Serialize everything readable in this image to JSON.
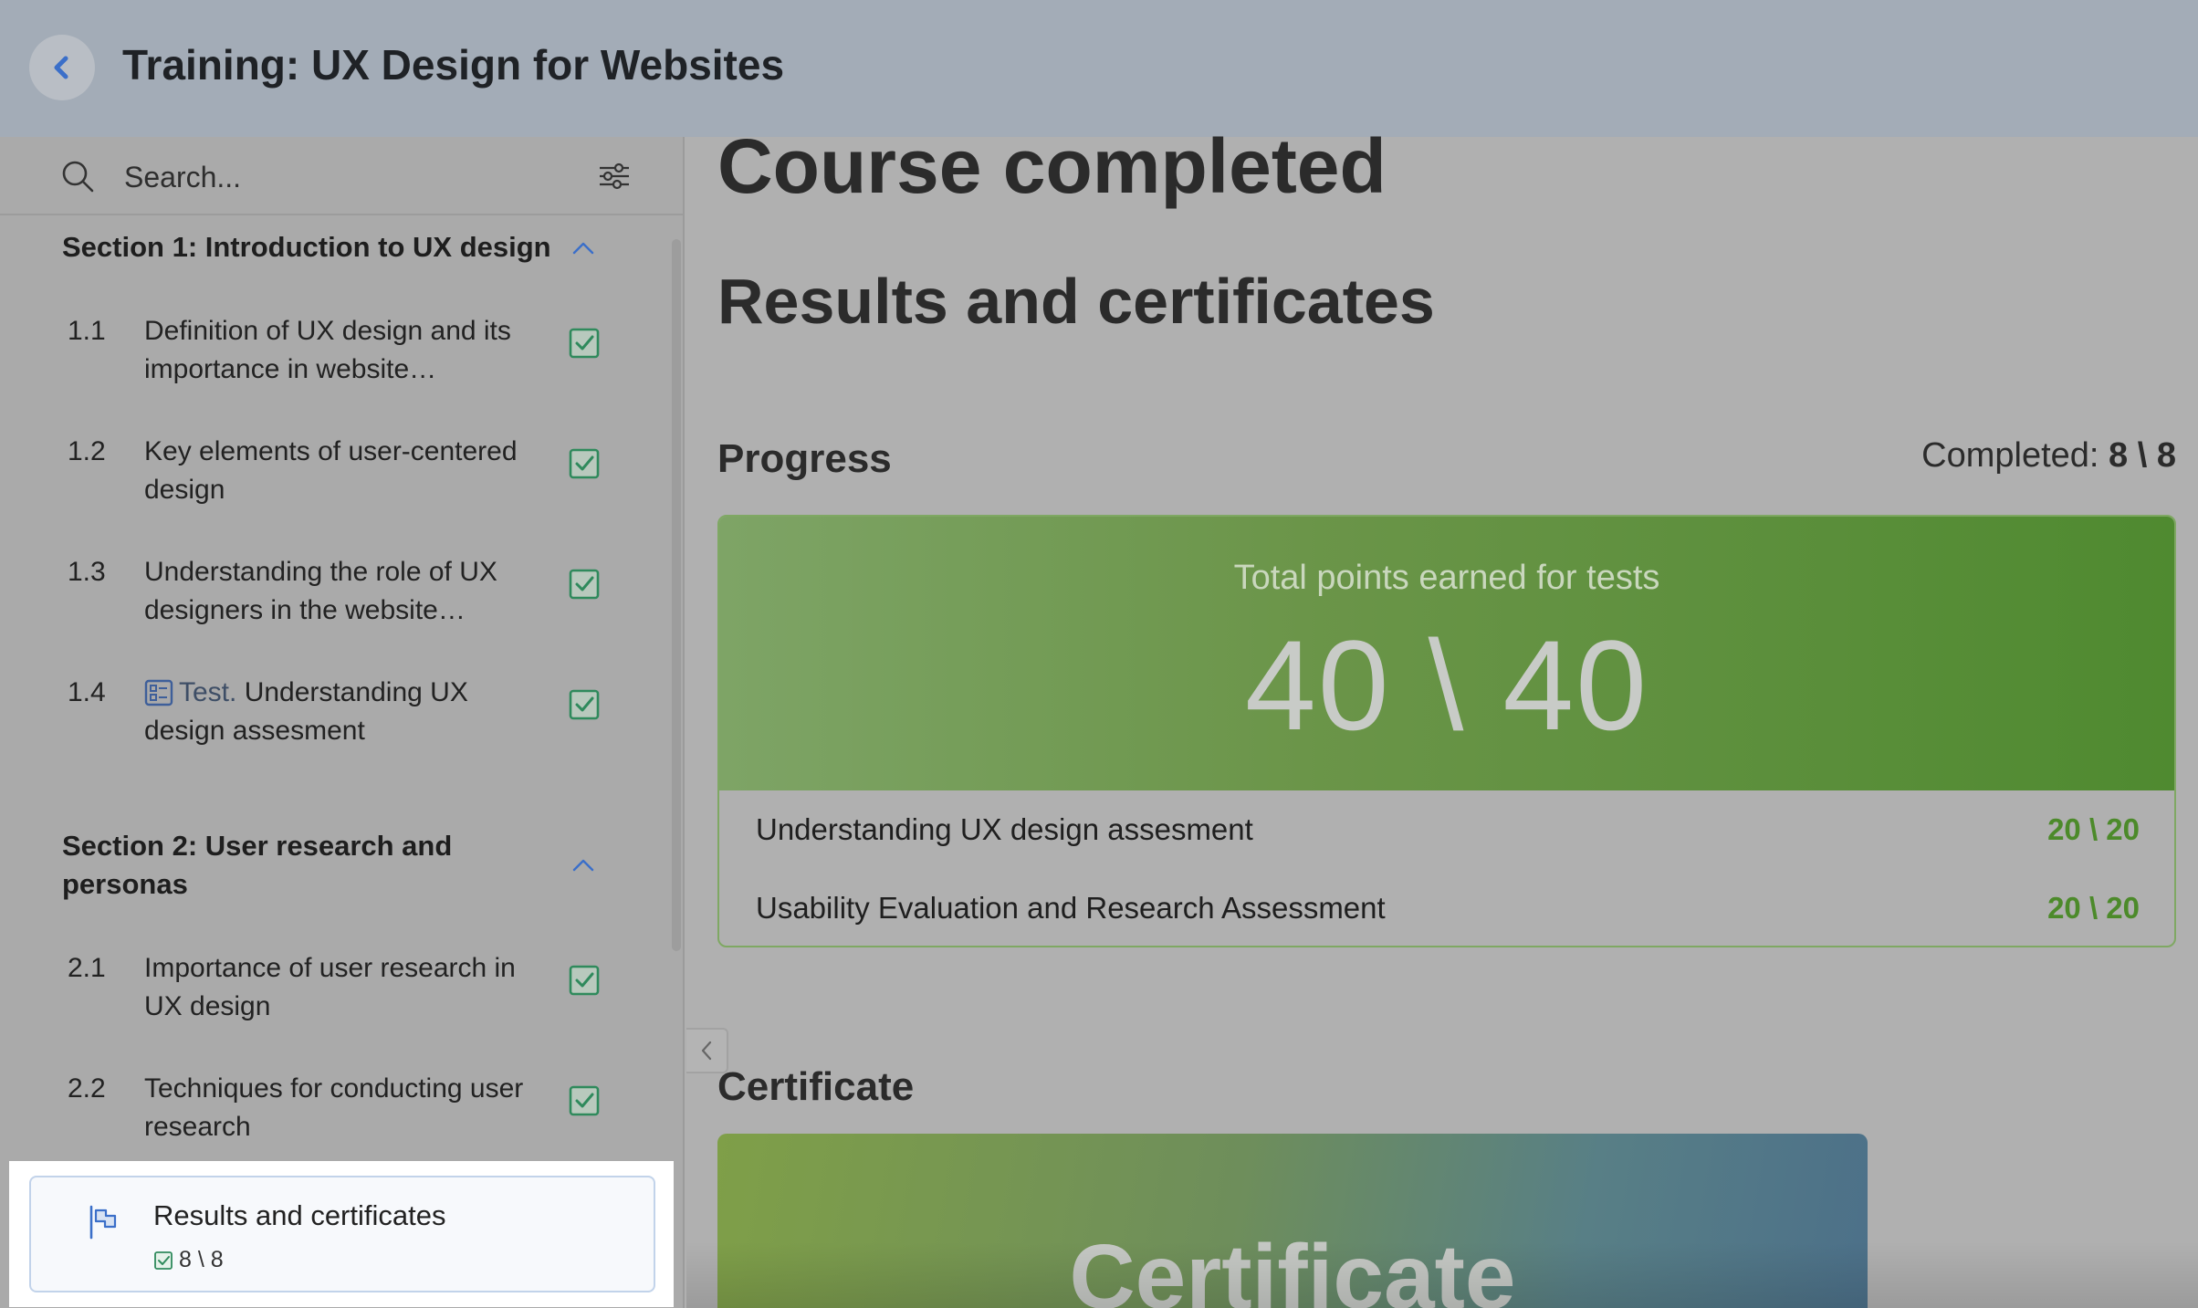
{
  "header": {
    "title": "Training: UX Design for Websites"
  },
  "search": {
    "placeholder": "Search..."
  },
  "sidebar": {
    "sections": [
      {
        "title": "Section 1: Introduction to UX design",
        "lessons": [
          {
            "num": "1.1",
            "text": "Definition of UX design and its importance in website…"
          },
          {
            "num": "1.2",
            "text": "Key elements of user-centered design"
          },
          {
            "num": "1.3",
            "text": "Understanding the role of UX designers in the website…"
          },
          {
            "num": "1.4",
            "prefix": "Test.",
            "text": "Understanding UX design assesment"
          }
        ]
      },
      {
        "title": "Section 2: User research and personas",
        "lessons": [
          {
            "num": "2.1",
            "text": "Importance of user research in UX design"
          },
          {
            "num": "2.2",
            "text": "Techniques for conducting user research"
          }
        ]
      }
    ],
    "results": {
      "title": "Results and certificates",
      "count": "8 \\ 8"
    }
  },
  "main": {
    "course_status": "Course completed",
    "heading": "Results and certificates",
    "progress": {
      "label": "Progress",
      "completed_label": "Completed:",
      "completed_value": "8 \\ 8",
      "total_label": "Total points earned for tests",
      "total_value": "40 \\ 40",
      "tests": [
        {
          "name": "Understanding UX design assesment",
          "score": "20 \\ 20"
        },
        {
          "name": "Usability Evaluation and Research Assessment",
          "score": "20 \\ 20"
        }
      ]
    },
    "certificate": {
      "label": "Certificate",
      "card_text": "Certificate"
    }
  },
  "colors": {
    "header_bg": "#a3acb7",
    "accent_blue": "#3b6fc9",
    "success_green": "#4c8a2a",
    "check_green": "#2f8a5c"
  },
  "icons": [
    "back-chevron-icon",
    "search-icon",
    "filter-icon",
    "chevron-up-icon",
    "checkbox-checked-icon",
    "test-list-icon",
    "flag-icon",
    "chevron-left-icon"
  ]
}
